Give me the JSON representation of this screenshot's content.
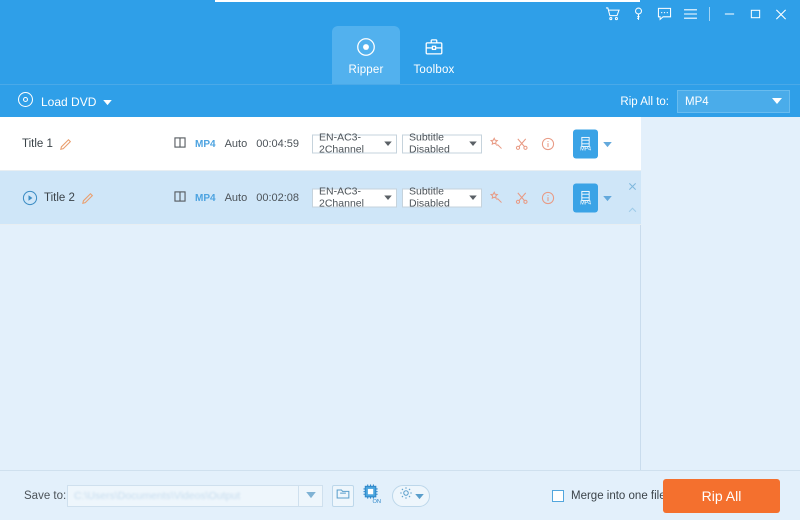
{
  "titlebar": {
    "icons": [
      {
        "name": "cart-icon",
        "label": "Shopping Cart"
      },
      {
        "name": "key-icon",
        "label": "Register"
      },
      {
        "name": "feedback-icon",
        "label": "Feedback"
      },
      {
        "name": "menu-icon",
        "label": "Menu"
      }
    ],
    "window_controls": [
      {
        "name": "minimize-button",
        "label": "Minimize"
      },
      {
        "name": "maximize-button",
        "label": "Maximize"
      },
      {
        "name": "close-button",
        "label": "Close"
      }
    ]
  },
  "tabs": [
    {
      "label": "Ripper",
      "icon": "disc-icon",
      "active": true
    },
    {
      "label": "Toolbox",
      "icon": "toolbox-icon",
      "active": false
    }
  ],
  "toolbar": {
    "load_dvd_label": "Load DVD",
    "load_dvd_icon": "disc-icon",
    "rip_all_to_label": "Rip All to:",
    "rip_all_to_value": "MP4"
  },
  "list": {
    "rows": [
      {
        "title": "Title 1",
        "has_play": false,
        "edit_icon": "pencil-icon",
        "source_icon": "video-track-icon",
        "format": "MP4",
        "quality": "Auto",
        "duration": "00:04:59",
        "audio": "EN-AC3-2Channel",
        "subtitle": "Subtitle Disabled",
        "tools": [
          "effects-icon",
          "cut-icon",
          "info-icon"
        ],
        "output_format": "MP4",
        "selected": false
      },
      {
        "title": "Title 2",
        "has_play": true,
        "edit_icon": "pencil-icon",
        "source_icon": "video-track-icon",
        "format": "MP4",
        "quality": "Auto",
        "duration": "00:02:08",
        "audio": "EN-AC3-2Channel",
        "subtitle": "Subtitle Disabled",
        "tools": [
          "effects-icon",
          "cut-icon",
          "info-icon"
        ],
        "output_format": "MP4",
        "selected": true
      }
    ]
  },
  "bottombar": {
    "save_to_label": "Save to:",
    "save_to_value": "C:\\Users\\Documents\\Videos\\Output",
    "folder_icon": "folder-icon",
    "gpu_icon": "gpu-acceleration-icon",
    "gpu_state": "ON",
    "gear_icon": "gear-icon",
    "merge_label": "Merge into one file",
    "merge_checked": false,
    "rip_all_label": "Rip All"
  },
  "colors": {
    "brand_blue": "#2f9fe8",
    "tab_active": "#52b1ee",
    "row_selected": "#cfe6f8",
    "panel_bg": "#e3f0fb",
    "accent_orange": "#f4702e",
    "tool_icon": "#e8a48c"
  }
}
